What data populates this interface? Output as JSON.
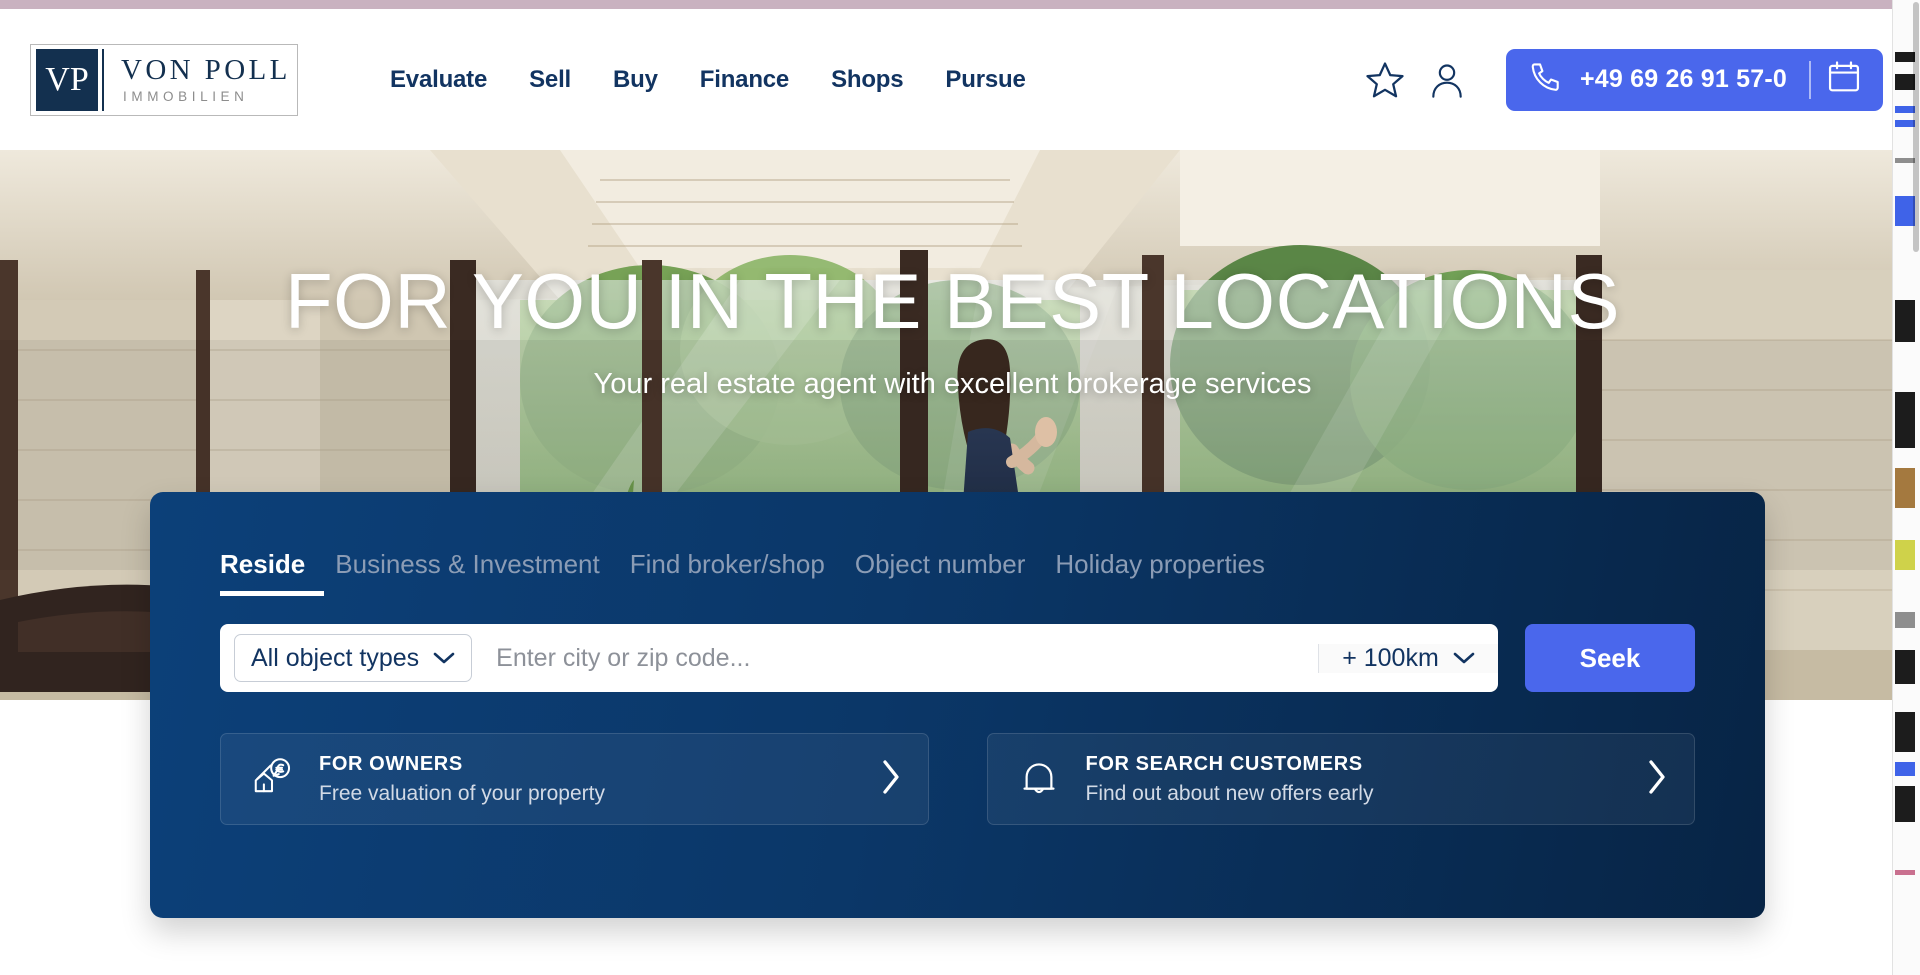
{
  "brand": {
    "logo_mark": "VP",
    "logo_name": "VON POLL",
    "logo_sub": "IMMOBILIEN",
    "navy": "#13304f",
    "panel_navy": "#0b3768",
    "accent_blue": "#4a67ec"
  },
  "header": {
    "nav": [
      {
        "label": "Evaluate"
      },
      {
        "label": "Sell"
      },
      {
        "label": "Buy"
      },
      {
        "label": "Finance"
      },
      {
        "label": "Shops"
      },
      {
        "label": "Pursue"
      }
    ],
    "favorites_icon": "star-icon",
    "account_icon": "user-icon",
    "phone_icon": "phone-icon",
    "phone_number": "+49 69 26 91 57-0",
    "calendar_icon": "calendar-icon"
  },
  "hero": {
    "title": "FOR YOU IN THE BEST LOCATIONS",
    "subtitle": "Your real estate agent with excellent brokerage services"
  },
  "search_panel": {
    "tabs": [
      {
        "label": "Reside",
        "active": true
      },
      {
        "label": "Business & Investment",
        "active": false
      },
      {
        "label": "Find broker/shop",
        "active": false
      },
      {
        "label": "Object number",
        "active": false
      },
      {
        "label": "Holiday properties",
        "active": false
      }
    ],
    "object_type": {
      "value": "All object types",
      "chevron_icon": "chevron-down-icon"
    },
    "location": {
      "value": "",
      "placeholder": "Enter city or zip code..."
    },
    "radius": {
      "value": "+ 100km",
      "chevron_icon": "chevron-down-icon"
    },
    "seek_button": "Seek",
    "cards": [
      {
        "icon": "house-euro-valuation-icon",
        "title": "FOR OWNERS",
        "subtitle": "Free valuation of your property",
        "chevron_icon": "chevron-right-icon"
      },
      {
        "icon": "bell-icon",
        "title": "FOR SEARCH CUSTOMERS",
        "subtitle": "Find out about new offers early",
        "chevron_icon": "chevron-right-icon"
      }
    ]
  }
}
